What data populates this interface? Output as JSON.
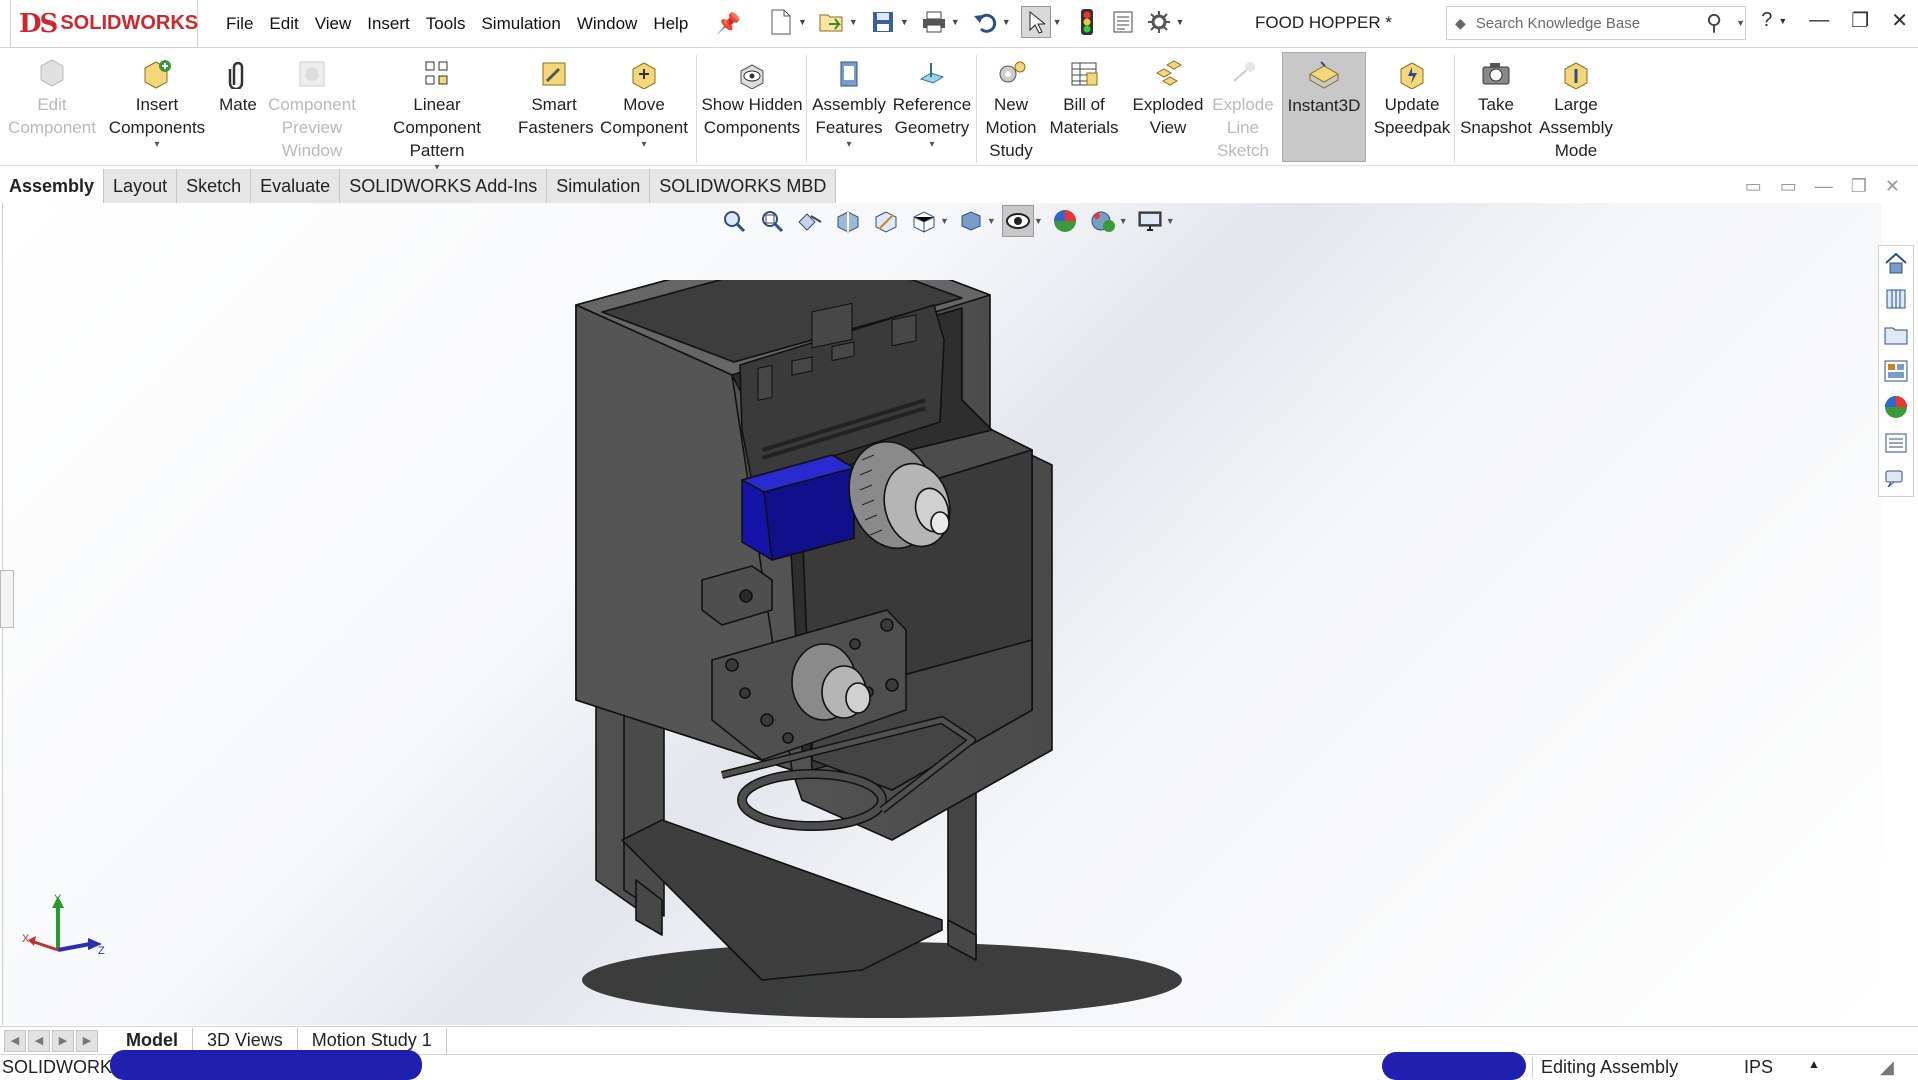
{
  "app": {
    "brand": "SOLIDWORKS",
    "document_title": "FOOD HOPPER *"
  },
  "menu": [
    "File",
    "Edit",
    "View",
    "Insert",
    "Tools",
    "Simulation",
    "Window",
    "Help"
  ],
  "search": {
    "placeholder": "Search Knowledge Base"
  },
  "ribbon": [
    {
      "label": "Edit Component",
      "enabled": false
    },
    {
      "label": "Insert Components",
      "enabled": true
    },
    {
      "label": "Mate",
      "enabled": true
    },
    {
      "label": "Component Preview Window",
      "enabled": false
    },
    {
      "label": "Linear Component Pattern",
      "enabled": true
    },
    {
      "label": "Smart Fasteners",
      "enabled": true
    },
    {
      "label": "Move Component",
      "enabled": true
    },
    {
      "label": "Show Hidden Components",
      "enabled": true
    },
    {
      "label": "Assembly Features",
      "enabled": true
    },
    {
      "label": "Reference Geometry",
      "enabled": true
    },
    {
      "label": "New Motion Study",
      "enabled": true
    },
    {
      "label": "Bill of Materials",
      "enabled": true
    },
    {
      "label": "Exploded View",
      "enabled": true
    },
    {
      "label": "Explode Line Sketch",
      "enabled": false
    },
    {
      "label": "Instant3D",
      "enabled": true,
      "active": true
    },
    {
      "label": "Update Speedpak",
      "enabled": true
    },
    {
      "label": "Take Snapshot",
      "enabled": true
    },
    {
      "label": "Large Assembly Mode",
      "enabled": true
    }
  ],
  "tabs": [
    "Assembly",
    "Layout",
    "Sketch",
    "Evaluate",
    "SOLIDWORKS Add-Ins",
    "Simulation",
    "SOLIDWORKS MBD"
  ],
  "active_tab": "Assembly",
  "bottom_tabs": [
    "Model",
    "3D Views",
    "Motion Study 1"
  ],
  "active_bottom_tab": "Model",
  "triad": {
    "x": "X",
    "y": "Y",
    "z": "Z"
  },
  "status": {
    "app": "SOLIDWORKS",
    "mode": "Editing Assembly",
    "units": "IPS"
  },
  "colors": {
    "accent": "#d0262d",
    "servo": "#1414a8",
    "model": "#555555"
  }
}
